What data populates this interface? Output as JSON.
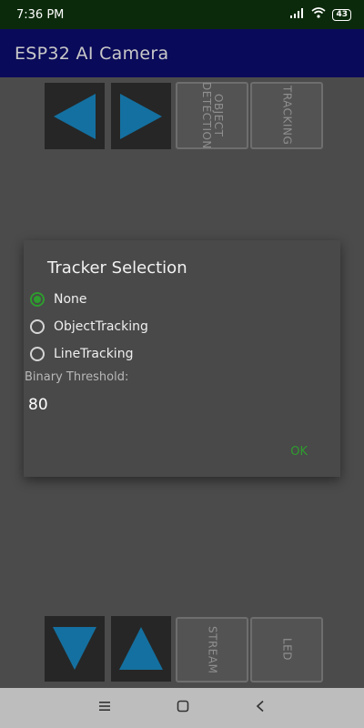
{
  "status_bar": {
    "time": "7:36 PM",
    "battery": "43",
    "signal_icon": "signal-icon",
    "wifi_icon": "wifi-icon"
  },
  "app_bar": {
    "title": "ESP32 AI Camera"
  },
  "top_controls": {
    "left_arrow_icon": "left-arrow-icon",
    "right_arrow_icon": "right-arrow-icon",
    "object_detection_label": "OBJECT DETECTION",
    "tracking_label": "TRACKING"
  },
  "dialog": {
    "title": "Tracker Selection",
    "options": [
      {
        "label": "None",
        "selected": true
      },
      {
        "label": "ObjectTracking",
        "selected": false
      },
      {
        "label": "LineTracking",
        "selected": false
      }
    ],
    "threshold_label": "Binary Threshold:",
    "threshold_value": "80",
    "ok_label": "OK"
  },
  "bottom_controls": {
    "down_arrow_icon": "down-arrow-icon",
    "up_arrow_icon": "up-arrow-icon",
    "stream_label": "STREAM",
    "led_label": "LED"
  },
  "nav_bar": {
    "menu_icon": "menu-icon",
    "home_icon": "home-icon",
    "back_icon": "back-icon"
  },
  "colors": {
    "accent_green": "#2e9c2e",
    "arrow_blue": "#1470a0",
    "app_bar": "#0a0a5a",
    "status_bar": "#0b2a0b"
  }
}
